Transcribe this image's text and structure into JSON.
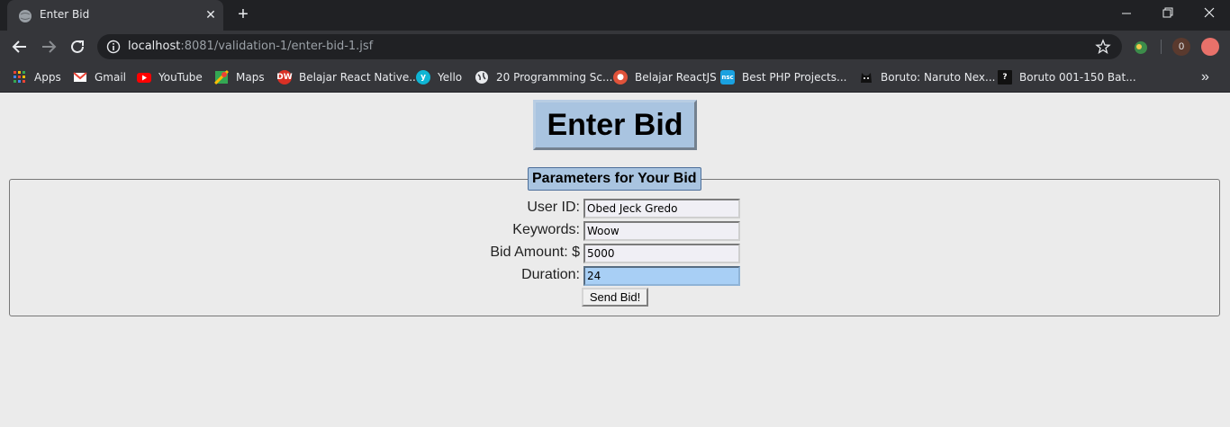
{
  "browser": {
    "tab_title": "Enter Bid",
    "url_host": "localhost",
    "url_rest": ":8081/validation-1/enter-bid-1.jsf",
    "extension_badge": "0",
    "bookmarks": [
      {
        "label": "Apps",
        "icon": "apps-grid-icon",
        "color": "#e8eaed"
      },
      {
        "label": "Gmail",
        "icon": "gmail-icon",
        "color": "#ea4335"
      },
      {
        "label": "YouTube",
        "icon": "youtube-icon",
        "color": "#ff0000"
      },
      {
        "label": "Maps",
        "icon": "maps-icon",
        "color": "#34a853"
      },
      {
        "label": "Belajar React Native...",
        "icon": "dw-icon",
        "color": "#d93025"
      },
      {
        "label": "Yello",
        "icon": "yello-icon",
        "color": "#0fb5d4"
      },
      {
        "label": "20 Programming Sc...",
        "icon": "globe-icon",
        "color": "#e8eaed"
      },
      {
        "label": "Belajar ReactJS",
        "icon": "react-icon",
        "color": "#e0533a"
      },
      {
        "label": "Best PHP Projects...",
        "icon": "nsc-icon",
        "color": "#1aa1e0"
      },
      {
        "label": "Boruto: Naruto Nex...",
        "icon": "cat-icon",
        "color": "#202124"
      },
      {
        "label": "Boruto 001-150 Bat...",
        "icon": "question-icon",
        "color": "#111111"
      }
    ]
  },
  "page": {
    "heading": "Enter Bid",
    "legend": "Parameters for Your Bid",
    "fields": [
      {
        "label": "User ID:",
        "value": "Obed Jeck Gredo"
      },
      {
        "label": "Keywords:",
        "value": "Woow"
      },
      {
        "label": "Bid Amount: $",
        "value": "5000"
      },
      {
        "label": "Duration:",
        "value": "24"
      }
    ],
    "submit_label": "Send Bid!"
  },
  "colors": {
    "heading_bg": "#a9c4e0",
    "active_input_bg": "#a8cff5",
    "page_bg": "#ebebeb"
  }
}
